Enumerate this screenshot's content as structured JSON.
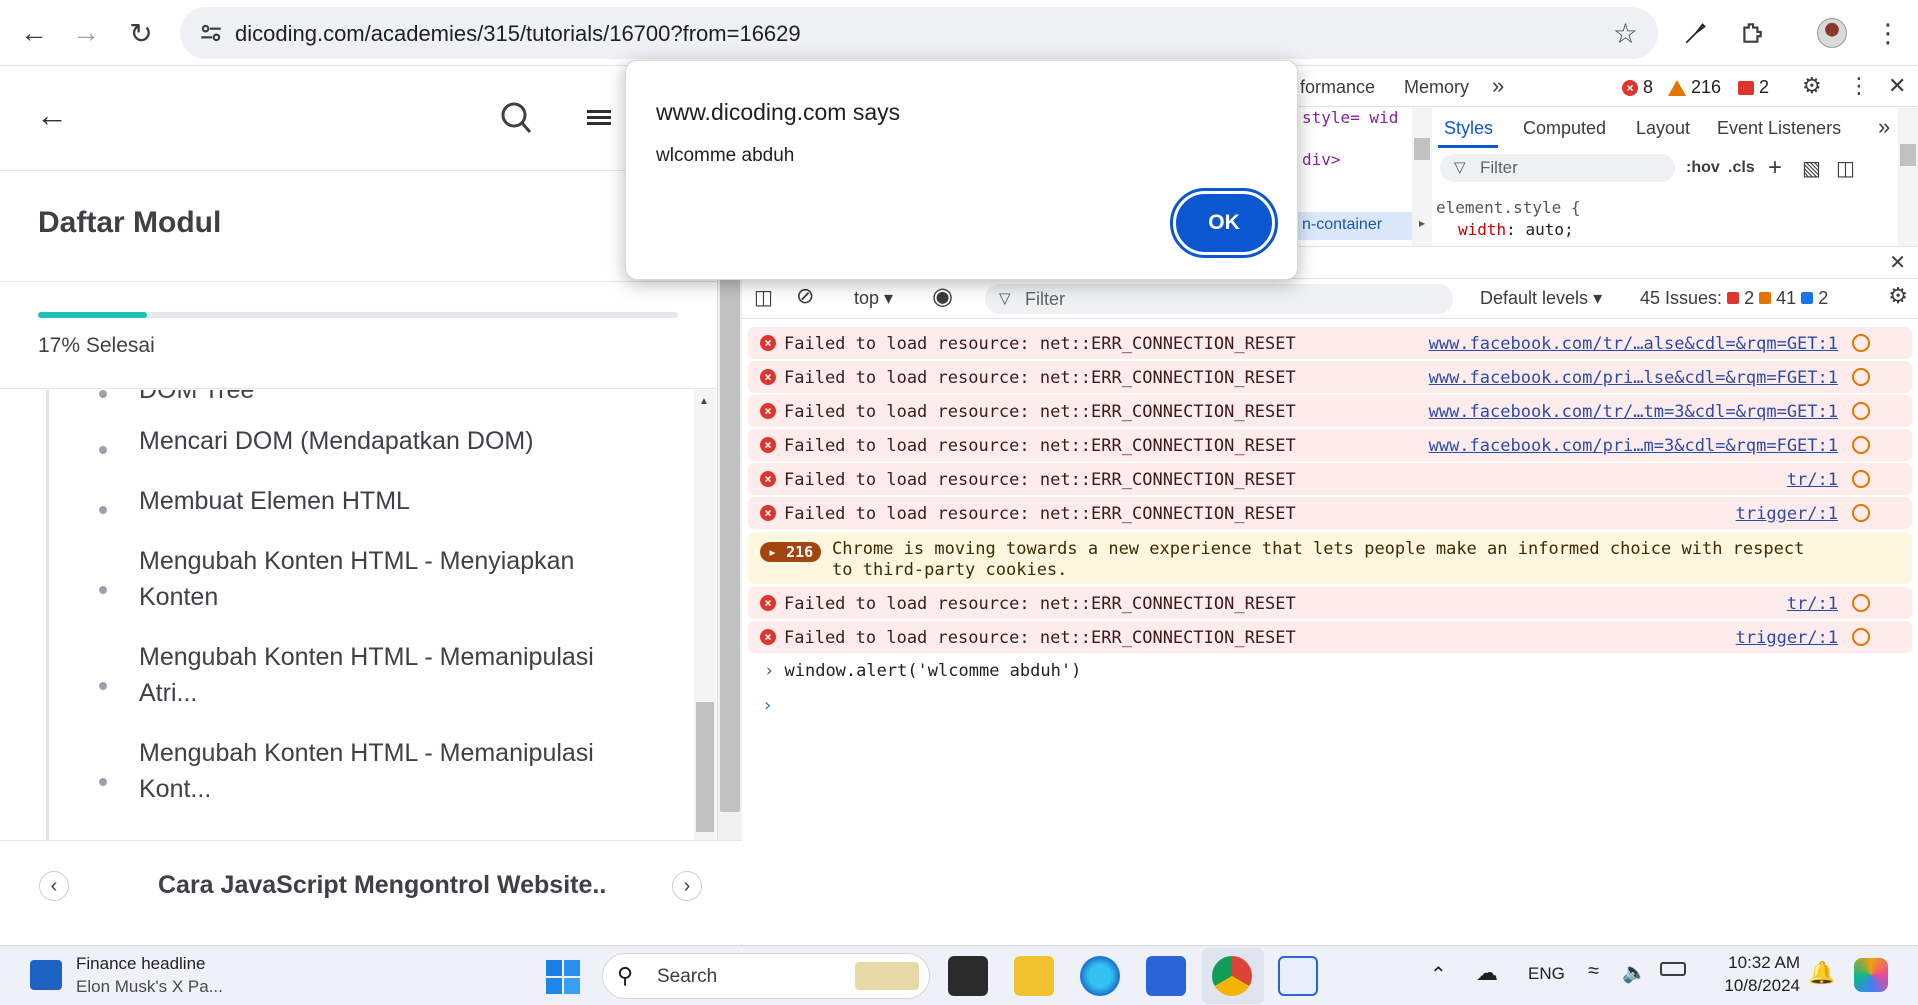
{
  "browser": {
    "url": "dicoding.com/academies/315/tutorials/16700?from=16629"
  },
  "page": {
    "modul_title": "Daftar Modul",
    "progress_label": "17% Selesai",
    "progress_fraction": 0.17,
    "modules": [
      "DOM Tree",
      "Mencari DOM (Mendapatkan DOM)",
      "Membuat Elemen HTML",
      "Mengubah Konten HTML - Menyiapkan Konten",
      "Mengubah Konten HTML - Memanipulasi Atri...",
      "Mengubah Konten HTML - Memanipulasi Kont..."
    ],
    "footer_title": "Cara JavaScript Mengontrol Website.."
  },
  "dialog": {
    "title": "www.dicoding.com says",
    "message": "wlcomme abduh",
    "ok_label": "OK"
  },
  "devtools": {
    "tabs": [
      "formance",
      "Memory"
    ],
    "error_count": "8",
    "warning_count": "216",
    "issue_count": "2",
    "elements_lines": [
      "style= wid",
      "div>",
      "n-container"
    ],
    "styles_tabs": [
      "Styles",
      "Computed",
      "Layout",
      "Event Listeners"
    ],
    "styles_filter_placeholder": "Filter",
    "hov": ":hov",
    "cls": ".cls",
    "element_style_selector": "element.style {",
    "element_style_prop": "width",
    "element_style_value": "auto;",
    "console": {
      "context": "top",
      "filter_placeholder": "Filter",
      "levels": "Default levels",
      "issues_label": "45 Issues:",
      "issues_errors": "2",
      "issues_warnings": "41",
      "issues_info": "2",
      "logs": [
        {
          "type": "error",
          "msg": "Failed to load resource: net::ERR_CONNECTION_RESET",
          "src": "www.facebook.com/tr/…alse&cdl=&rqm=GET:1"
        },
        {
          "type": "error",
          "msg": "Failed to load resource: net::ERR_CONNECTION_RESET",
          "src": "www.facebook.com/pri…lse&cdl=&rqm=FGET:1"
        },
        {
          "type": "error",
          "msg": "Failed to load resource: net::ERR_CONNECTION_RESET",
          "src": "www.facebook.com/tr/…tm=3&cdl=&rqm=GET:1"
        },
        {
          "type": "error",
          "msg": "Failed to load resource: net::ERR_CONNECTION_RESET",
          "src": "www.facebook.com/pri…m=3&cdl=&rqm=FGET:1"
        },
        {
          "type": "error",
          "msg": "Failed to load resource: net::ERR_CONNECTION_RESET",
          "src": "tr/:1"
        },
        {
          "type": "error",
          "msg": "Failed to load resource: net::ERR_CONNECTION_RESET",
          "src": "trigger/:1"
        },
        {
          "type": "warning",
          "count": "216",
          "msg": "Chrome is moving towards a new experience that lets people make an informed choice with respect to third-party cookies."
        },
        {
          "type": "error",
          "msg": "Failed to load resource: net::ERR_CONNECTION_RESET",
          "src": "tr/:1"
        },
        {
          "type": "error",
          "msg": "Failed to load resource: net::ERR_CONNECTION_RESET",
          "src": "trigger/:1"
        }
      ],
      "command": "window.alert('wlcomme abduh')"
    }
  },
  "taskbar": {
    "news_title": "Finance headline",
    "news_sub": "Elon Musk's X Pa...",
    "search_placeholder": "Search",
    "lang": "ENG",
    "time": "10:32 AM",
    "date": "10/8/2024"
  },
  "colors": {
    "progress": "#1ec1b6",
    "dialog_ok": "#0b57d0",
    "error": "#dc362e"
  }
}
